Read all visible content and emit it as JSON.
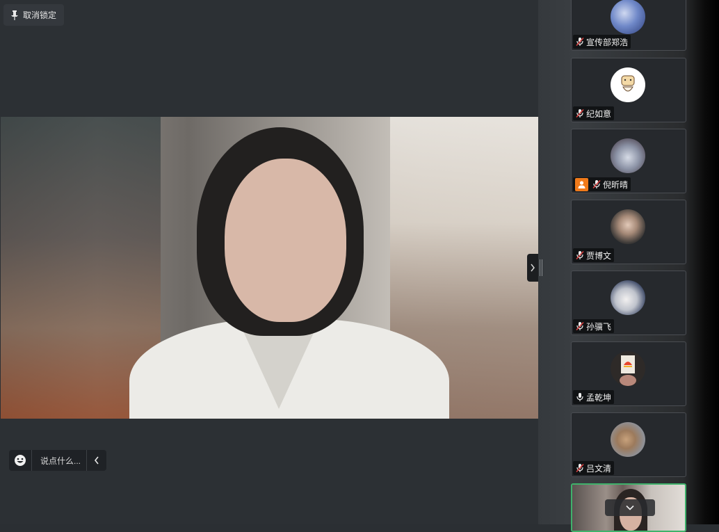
{
  "toolbar": {
    "unpin_label": "取消锁定"
  },
  "chat": {
    "placeholder": "说点什么..."
  },
  "participants": [
    {
      "name": "宣传部郑浩",
      "mic": "muted",
      "avatar": "blue-sky-avatar"
    },
    {
      "name": "纪如意",
      "mic": "muted",
      "avatar": "cartoon-avatar"
    },
    {
      "name": "倪昕晴",
      "mic": "muted",
      "host": true,
      "avatar": "anime-avatar"
    },
    {
      "name": "贾博文",
      "mic": "muted",
      "avatar": "photo-avatar"
    },
    {
      "name": "孙骥飞",
      "mic": "muted",
      "avatar": "anime-boy-avatar"
    },
    {
      "name": "孟乾坤",
      "mic": "on",
      "avatar": "logo-avatar"
    },
    {
      "name": "吕文清",
      "mic": "muted",
      "avatar": "dog-avatar"
    }
  ],
  "colors": {
    "accent_active": "#3fb26b",
    "host_badge": "#f07a1a",
    "muted_icon": "#d94040"
  }
}
